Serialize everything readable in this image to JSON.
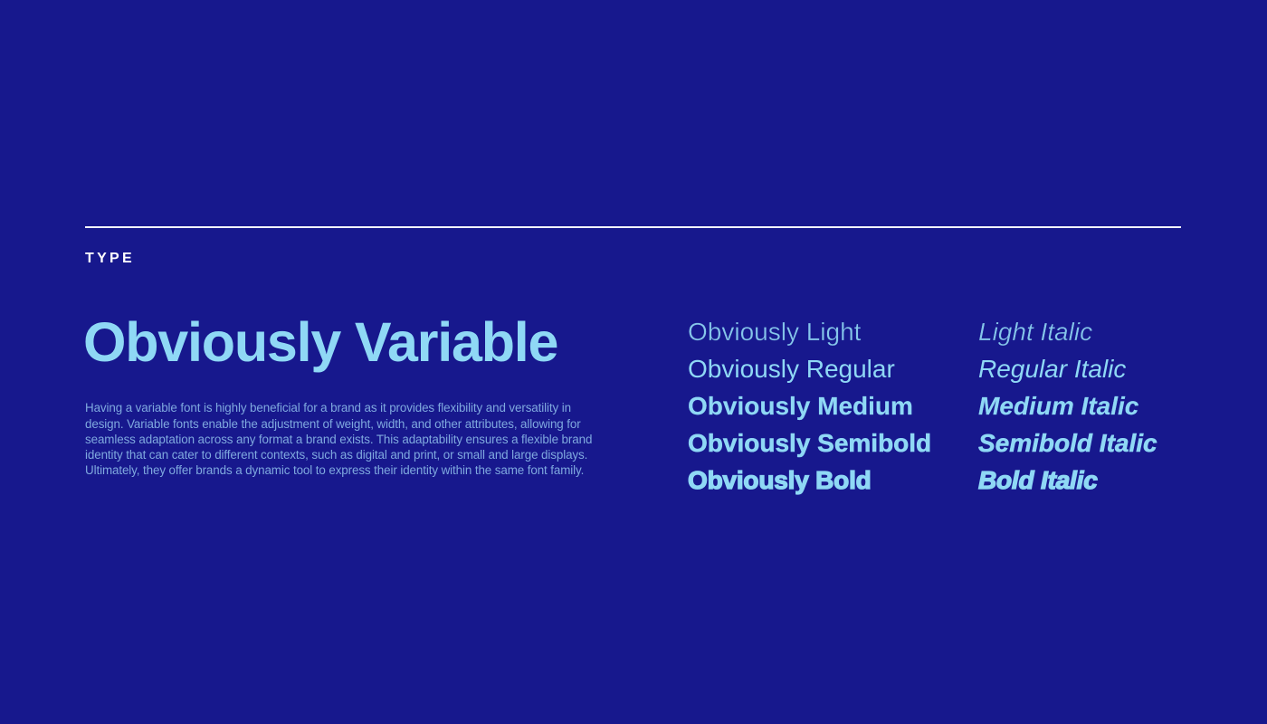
{
  "theme": {
    "background": "#17188D",
    "rule": "#F2F4FB",
    "label": "#FFFFFF",
    "accent": "#8FD8F5",
    "body_text": "#7FA9DF",
    "light_weight": "#86C6EA"
  },
  "section": {
    "label": "TYPE"
  },
  "feature": {
    "headline": "Obviously Variable",
    "paragraph": "Having a variable font is highly beneficial for a brand as it provides flexibility and versatility in design. Variable fonts enable the adjustment of weight, width, and other attributes, allowing for seamless adaptation across any format a brand exists. This adaptability ensures a flexible brand identity that can cater to different contexts, such as digital and print, or small and large displays. Ultimately, they offer brands a dynamic tool to express their identity within the same font family."
  },
  "specimen": {
    "rows": [
      {
        "upright": "Obviously Light",
        "italic": "Light Italic"
      },
      {
        "upright": "Obviously Regular",
        "italic": "Regular Italic"
      },
      {
        "upright": "Obviously Medium",
        "italic": "Medium Italic"
      },
      {
        "upright": "Obviously Semibold",
        "italic": "Semibold Italic"
      },
      {
        "upright": "Obviously Bold",
        "italic": "Bold Italic"
      }
    ]
  }
}
